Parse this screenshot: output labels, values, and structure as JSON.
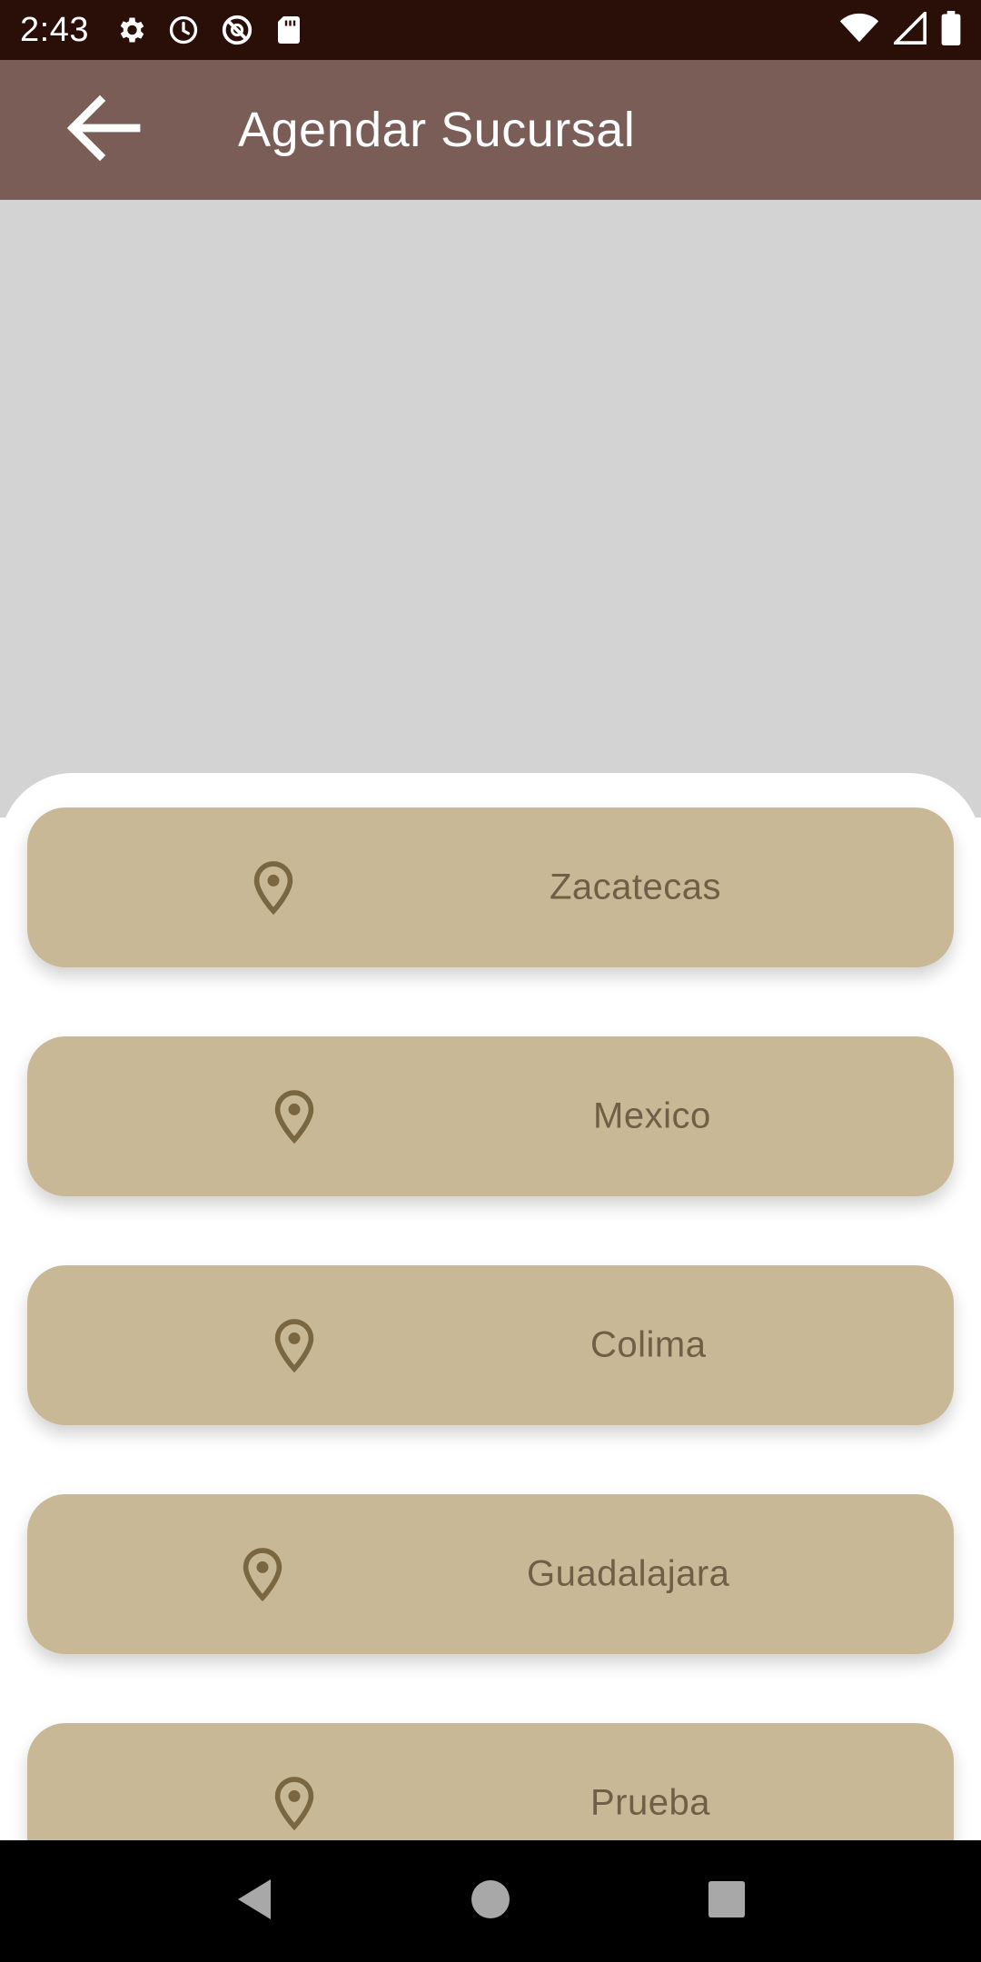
{
  "status_bar": {
    "time": "2:43",
    "left_icons": [
      "settings-icon",
      "alarm-icon",
      "do-not-disturb-icon",
      "sd-card-icon"
    ],
    "right_icons": [
      "wifi-icon",
      "signal-icon",
      "battery-icon"
    ]
  },
  "app_bar": {
    "title": "Agendar Sucursal",
    "back_icon": "arrow-back-icon"
  },
  "branches": [
    {
      "label": "Zacatecas",
      "icon": "location-pin-icon"
    },
    {
      "label": "Mexico",
      "icon": "location-pin-icon"
    },
    {
      "label": "Colima",
      "icon": "location-pin-icon"
    },
    {
      "label": "Guadalajara",
      "icon": "location-pin-icon"
    },
    {
      "label": "Prueba",
      "icon": "location-pin-icon"
    }
  ],
  "nav_bar": {
    "buttons": [
      "back-triangle-icon",
      "home-circle-icon",
      "recents-square-icon"
    ]
  },
  "colors": {
    "status_bar": "#2a0f08",
    "app_bar": "#7b5d57",
    "map_placeholder": "#d3d3d3",
    "card": "#c8b895",
    "card_text": "#6f5f46",
    "pin": "#7a6742"
  }
}
